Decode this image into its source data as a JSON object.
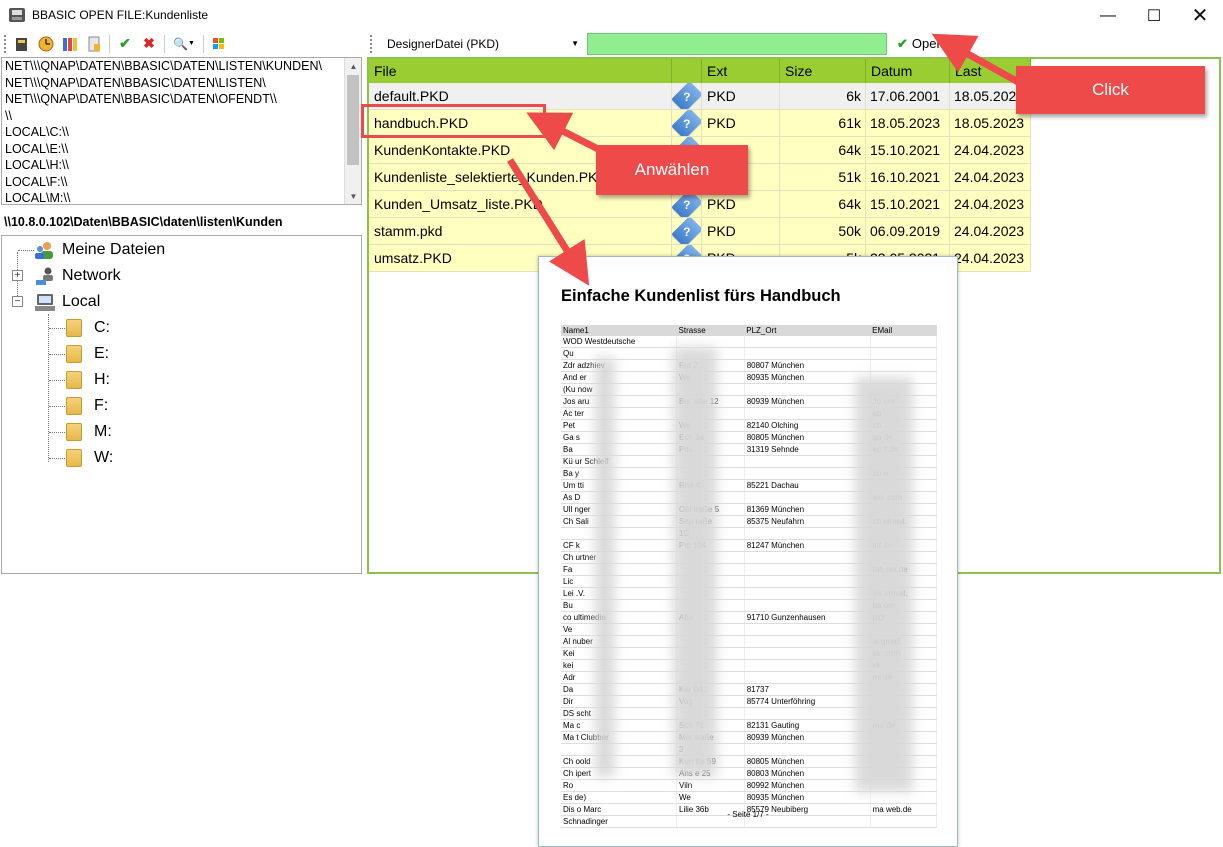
{
  "window": {
    "title": "BBASIC OPEN FILE:Kundenliste",
    "minimize": "—",
    "maximize": "☐",
    "close": "✕"
  },
  "toolbar": {
    "file_type": "DesignerDatei (PKD)",
    "file_name_value": "",
    "open_label": "Open"
  },
  "paths": [
    "NET\\\\\\QNAP\\DATEN\\BBASIC\\DATEN\\LISTEN\\KUNDEN\\",
    "NET\\\\\\QNAP\\DATEN\\BBASIC\\DATEN\\LISTEN\\",
    "NET\\\\\\QNAP\\DATEN\\BBASIC\\DATEN\\OFENDT\\\\",
    "\\\\",
    "LOCAL\\C:\\\\",
    "LOCAL\\E:\\\\",
    "LOCAL\\H:\\\\",
    "LOCAL\\F:\\\\",
    "LOCAL\\M:\\\\"
  ],
  "current_path": "\\\\10.8.0.102\\Daten\\BBASIC\\daten\\listen\\Kunden",
  "tree": {
    "my_files": "Meine Dateien",
    "network": "Network",
    "local": "Local",
    "drives": [
      "C:",
      "E:",
      "H:",
      "F:",
      "M:",
      "W:"
    ]
  },
  "grid": {
    "headers": {
      "file": "File",
      "ext": "Ext",
      "size": "Size",
      "date": "Datum",
      "last": "Last"
    },
    "rows": [
      {
        "file": "default.PKD",
        "ext": "PKD",
        "size": "6k",
        "date": "17.06.2001",
        "last": "18.05.2023"
      },
      {
        "file": "handbuch.PKD",
        "ext": "PKD",
        "size": "61k",
        "date": "18.05.2023",
        "last": "18.05.2023"
      },
      {
        "file": "KundenKontakte.PKD",
        "ext": "PKD",
        "size": "64k",
        "date": "15.10.2021",
        "last": "24.04.2023"
      },
      {
        "file": "Kundenliste_selektierte_Kunden.PKD",
        "ext": "PKD",
        "size": "51k",
        "date": "16.10.2021",
        "last": "24.04.2023"
      },
      {
        "file": "Kunden_Umsatz_liste.PKD",
        "ext": "PKD",
        "size": "64k",
        "date": "15.10.2021",
        "last": "24.04.2023"
      },
      {
        "file": "stamm.pkd",
        "ext": "PKD",
        "size": "50k",
        "date": "06.09.2019",
        "last": "24.04.2023"
      },
      {
        "file": "umsatz.PKD",
        "ext": "PKD",
        "size": "5k",
        "date": "23.05.2021",
        "last": "24.04.2023"
      }
    ]
  },
  "preview": {
    "title": "Einfache Kundenlist fürs Handbuch",
    "headers": [
      "Name1",
      "Strasse",
      "PLZ_Ort",
      "EMail"
    ],
    "rows": [
      [
        "WOD Westdeutsche",
        "",
        "",
        ""
      ],
      [
        "Qu",
        "",
        "",
        ""
      ],
      [
        "Zdr    adzhiev",
        "Fra          2",
        "80807 München",
        ""
      ],
      [
        "And       er",
        "We",
        "80935 München",
        ""
      ],
      [
        "(Ku      now",
        "",
        "",
        ""
      ],
      [
        "Jos       aru",
        "Bor         aße 12",
        "80939 München",
        "Jo              om"
      ],
      [
        "Ac        ter",
        "",
        "",
        "ab"
      ],
      [
        "Pet",
        "We",
        "82140 Olching",
        "ch"
      ],
      [
        "Ga        s",
        "Ech         3a",
        "80805 München",
        "ga             de"
      ],
      [
        "Ba",
        "Pos",
        "31319 Sehnde",
        "ko              if.de"
      ],
      [
        "Kü        ur Schleif",
        "",
        "",
        ""
      ],
      [
        "Ba        y",
        "",
        "",
        "bh              e"
      ],
      [
        "Um       tti",
        "Rhe         4",
        "85221 Dachau",
        ""
      ],
      [
        "As        D",
        "",
        "",
        "wo             .com"
      ],
      [
        "Ull        nger",
        "Ohl        traße 5",
        "81369 München",
        ""
      ],
      [
        "Ch        Sali",
        "Sep        raße",
        "85375 Neufahrn",
        "ch              otmail."
      ],
      [
        "",
        "1C",
        "",
        ""
      ],
      [
        "CF        k",
        "Pip          104",
        "81247 München",
        "inf              de"
      ],
      [
        "Ch        urtner",
        "",
        "",
        ""
      ],
      [
        "Fa",
        "",
        "",
        "fab             mx.de"
      ],
      [
        "Lic",
        "",
        "",
        ""
      ],
      [
        "Lei        .V.",
        "",
        "",
        "Ve              otmail."
      ],
      [
        "Bu",
        "",
        "",
        "ba              om"
      ],
      [
        "co        ultimedia",
        "Aha",
        "91710 Gunzenhausen",
        "p@"
      ],
      [
        "Ve",
        "",
        "",
        ""
      ],
      [
        "Al        nuber",
        "",
        "",
        "al               gmail."
      ],
      [
        "Kei",
        "",
        "",
        "sk              .com"
      ],
      [
        "kei",
        "",
        "",
        "vk"
      ],
      [
        "Adr",
        "",
        "",
        "mi              de"
      ],
      [
        "Da",
        "Kar         04",
        "81737",
        ""
      ],
      [
        "Dir",
        "Vog",
        "85774 Unterföhring",
        ""
      ],
      [
        "DS        scht",
        "",
        "",
        ""
      ],
      [
        "Ma        c",
        "Sch         7c",
        "82131 Gauting",
        "ma              de"
      ],
      [
        "Ma        t Clubbar",
        "Mar        traße",
        "80939 München",
        ""
      ],
      [
        "",
        "3",
        "",
        ""
      ],
      [
        "Ch        oold",
        "Kun         ße 59",
        "80805 München",
        ""
      ],
      [
        "Ch        ipert",
        "Ans         e 25",
        "80803 München",
        ""
      ],
      [
        "Ro",
        "Viln",
        "80992 München",
        ""
      ],
      [
        "Es        de)",
        "We",
        "80935 München",
        ""
      ],
      [
        "Dis        o Marc",
        "Lilie        36b",
        "85579 Neubiberg",
        "ma              web.de"
      ],
      [
        "Schnadinger",
        "",
        "",
        ""
      ]
    ],
    "footer": "- Seite 1/7 -"
  },
  "callouts": {
    "click": "Click",
    "select": "Anwählen"
  },
  "colors": {
    "grid_header": "#9acd32",
    "row_selected": "#f0f0f0",
    "row_default": "#ffffc0",
    "input_green": "#90ee90",
    "callout_red": "#ee4a4a"
  }
}
